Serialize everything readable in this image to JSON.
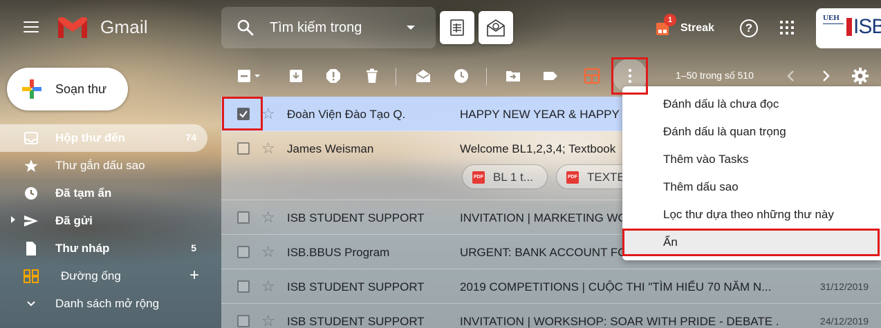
{
  "header": {
    "brand": "Gmail",
    "search_placeholder": "Tìm kiếm trong",
    "streak_label": "Streak",
    "streak_badge": "1",
    "org_logo_text": "ISB",
    "org_logo_small": "UEH"
  },
  "compose": {
    "label": "Soạn thư"
  },
  "nav": {
    "items": [
      {
        "label": "Hộp thư đến",
        "count": "74",
        "icon": "inbox-icon"
      },
      {
        "label": "Thư gắn dấu sao",
        "count": "",
        "icon": "star-icon"
      },
      {
        "label": "Đã tạm ẩn",
        "count": "",
        "icon": "clock-icon"
      },
      {
        "label": "Đã gửi",
        "count": "",
        "icon": "send-icon"
      },
      {
        "label": "Thư nháp",
        "count": "5",
        "icon": "draft-icon"
      },
      {
        "label": "Đường ống",
        "count": "",
        "icon": "pipeline-icon"
      },
      {
        "label": "Danh sách mở rộng",
        "count": "",
        "icon": "expand-icon"
      }
    ]
  },
  "toolbar": {
    "pagination": "1–50 trong số 510"
  },
  "emails": [
    {
      "sender": "Đoàn Viện Đào Tạo Q.",
      "subject": "HAPPY NEW YEAR & HAPPY N",
      "date": "",
      "selected": true
    },
    {
      "sender": "James Weisman",
      "subject": "Welcome BL1,2,3,4; Textbook",
      "date": "",
      "attachments": [
        "BL 1 t...",
        "TEXTB"
      ]
    },
    {
      "sender": "ISB STUDENT SUPPORT",
      "subject": "INVITATION | MARKETING WO",
      "date": ""
    },
    {
      "sender": "ISB.BBUS Program",
      "subject": "URGENT: BANK ACCOUNT FO",
      "date": ""
    },
    {
      "sender": "ISB STUDENT SUPPORT",
      "subject": "2019 COMPETITIONS | CUỘC THI \"TÌM HIỂU 70 NĂM N...",
      "date": "31/12/2019"
    },
    {
      "sender": "ISB STUDENT SUPPORT",
      "subject": "INVITATION | WORKSHOP: SOAR WITH PRIDE - DEBATE ...",
      "date": "24/12/2019"
    }
  ],
  "more_menu": {
    "items": [
      "Đánh dấu là chưa đọc",
      "Đánh dấu là quan trọng",
      "Thêm vào Tasks",
      "Thêm dấu sao",
      "Lọc thư dựa theo những thư này",
      "Ẩn"
    ]
  },
  "colors": {
    "highlight": "#e01a1a",
    "selected_row": "#c2d8ff",
    "gmail_red": "#ea4335"
  }
}
